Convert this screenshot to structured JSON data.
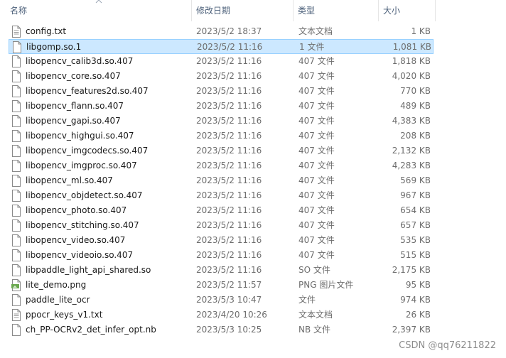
{
  "columns": {
    "name": "名称",
    "date": "修改日期",
    "type": "类型",
    "size": "大小"
  },
  "files": [
    {
      "name": "config.txt",
      "date": "2023/5/2 18:37",
      "type": "文本文档",
      "size": "1 KB",
      "icon": "text-file-icon"
    },
    {
      "name": "libgomp.so.1",
      "date": "2023/5/2 11:16",
      "type": "1 文件",
      "size": "1,081 KB",
      "icon": "blank-file-icon",
      "selected": true
    },
    {
      "name": "libopencv_calib3d.so.407",
      "date": "2023/5/2 11:16",
      "type": "407 文件",
      "size": "1,818 KB",
      "icon": "blank-file-icon"
    },
    {
      "name": "libopencv_core.so.407",
      "date": "2023/5/2 11:16",
      "type": "407 文件",
      "size": "4,020 KB",
      "icon": "blank-file-icon"
    },
    {
      "name": "libopencv_features2d.so.407",
      "date": "2023/5/2 11:16",
      "type": "407 文件",
      "size": "770 KB",
      "icon": "blank-file-icon"
    },
    {
      "name": "libopencv_flann.so.407",
      "date": "2023/5/2 11:16",
      "type": "407 文件",
      "size": "489 KB",
      "icon": "blank-file-icon"
    },
    {
      "name": "libopencv_gapi.so.407",
      "date": "2023/5/2 11:16",
      "type": "407 文件",
      "size": "4,383 KB",
      "icon": "blank-file-icon"
    },
    {
      "name": "libopencv_highgui.so.407",
      "date": "2023/5/2 11:16",
      "type": "407 文件",
      "size": "208 KB",
      "icon": "blank-file-icon"
    },
    {
      "name": "libopencv_imgcodecs.so.407",
      "date": "2023/5/2 11:16",
      "type": "407 文件",
      "size": "2,132 KB",
      "icon": "blank-file-icon"
    },
    {
      "name": "libopencv_imgproc.so.407",
      "date": "2023/5/2 11:16",
      "type": "407 文件",
      "size": "4,283 KB",
      "icon": "blank-file-icon"
    },
    {
      "name": "libopencv_ml.so.407",
      "date": "2023/5/2 11:16",
      "type": "407 文件",
      "size": "569 KB",
      "icon": "blank-file-icon"
    },
    {
      "name": "libopencv_objdetect.so.407",
      "date": "2023/5/2 11:16",
      "type": "407 文件",
      "size": "967 KB",
      "icon": "blank-file-icon"
    },
    {
      "name": "libopencv_photo.so.407",
      "date": "2023/5/2 11:16",
      "type": "407 文件",
      "size": "654 KB",
      "icon": "blank-file-icon"
    },
    {
      "name": "libopencv_stitching.so.407",
      "date": "2023/5/2 11:16",
      "type": "407 文件",
      "size": "657 KB",
      "icon": "blank-file-icon"
    },
    {
      "name": "libopencv_video.so.407",
      "date": "2023/5/2 11:16",
      "type": "407 文件",
      "size": "535 KB",
      "icon": "blank-file-icon"
    },
    {
      "name": "libopencv_videoio.so.407",
      "date": "2023/5/2 11:16",
      "type": "407 文件",
      "size": "515 KB",
      "icon": "blank-file-icon"
    },
    {
      "name": "libpaddle_light_api_shared.so",
      "date": "2023/5/2 11:16",
      "type": "SO 文件",
      "size": "2,175 KB",
      "icon": "blank-file-icon"
    },
    {
      "name": "lite_demo.png",
      "date": "2023/5/2 11:57",
      "type": "PNG 图片文件",
      "size": "95 KB",
      "icon": "png-image-icon"
    },
    {
      "name": "paddle_lite_ocr",
      "date": "2023/5/3 10:47",
      "type": "文件",
      "size": "974 KB",
      "icon": "blank-file-icon"
    },
    {
      "name": "ppocr_keys_v1.txt",
      "date": "2023/4/20 10:26",
      "type": "文本文档",
      "size": "26 KB",
      "icon": "text-file-icon"
    },
    {
      "name": "ch_PP-OCRv2_det_infer_opt.nb",
      "date": "2023/5/3 10:25",
      "type": "NB 文件",
      "size": "2,397 KB",
      "icon": "blank-file-icon"
    }
  ],
  "watermark": "CSDN @qq76211822",
  "colors": {
    "header_text": "#4c607a",
    "selection_bg": "#cce8ff",
    "selection_border": "#99d1ff",
    "secondary_text": "#6d6d6d"
  }
}
